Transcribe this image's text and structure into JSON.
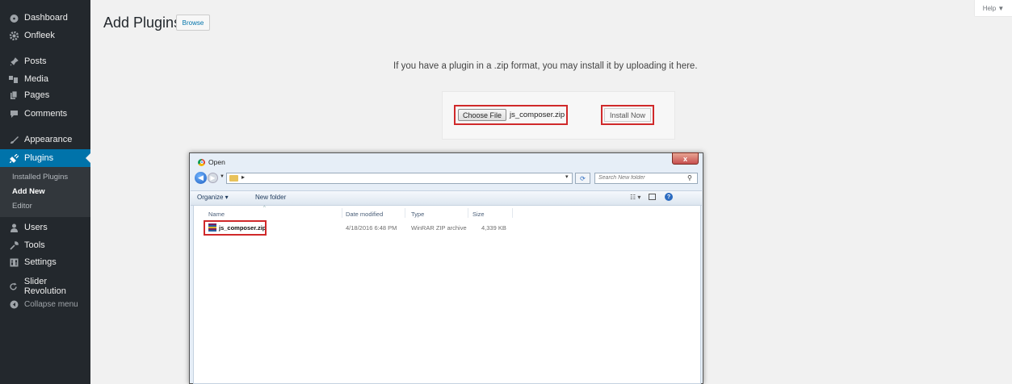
{
  "sidebar": {
    "items": [
      {
        "label": "Dashboard",
        "icon": "dashboard-icon"
      },
      {
        "label": "Onfleek",
        "icon": "gear-icon"
      },
      {
        "label": "Posts",
        "icon": "pin-icon"
      },
      {
        "label": "Media",
        "icon": "media-icon"
      },
      {
        "label": "Pages",
        "icon": "pages-icon"
      },
      {
        "label": "Comments",
        "icon": "comment-icon"
      },
      {
        "label": "Appearance",
        "icon": "brush-icon"
      },
      {
        "label": "Plugins",
        "icon": "plug-icon"
      },
      {
        "label": "Users",
        "icon": "user-icon"
      },
      {
        "label": "Tools",
        "icon": "wrench-icon"
      },
      {
        "label": "Settings",
        "icon": "settings-icon"
      },
      {
        "label": "Slider Revolution",
        "icon": "refresh-icon"
      },
      {
        "label": "Collapse menu",
        "icon": "collapse-icon"
      }
    ],
    "submenu": [
      "Installed Plugins",
      "Add New",
      "Editor"
    ]
  },
  "header": {
    "title": "Add Plugins",
    "browse_label": "Browse",
    "help_label": "Help ▼"
  },
  "upload": {
    "instruction": "If you have a plugin in a .zip format, you may install it by uploading it here.",
    "choose_label": "Choose File",
    "file_name": "js_composer.zip",
    "install_label": "Install Now"
  },
  "dialog": {
    "title": "Open",
    "close_label": "x",
    "search_placeholder": "Search New folder",
    "organize_label": "Organize ▾",
    "new_folder_label": "New folder",
    "columns": [
      "Name",
      "Date modified",
      "Type",
      "Size"
    ],
    "files": [
      {
        "name": "js_composer.zip",
        "date": "4/18/2016 6:48 PM",
        "type": "WinRAR ZIP archive",
        "size": "4,339 KB"
      }
    ]
  },
  "colors": {
    "sidebar_bg": "#23282d",
    "active": "#0073aa",
    "highlight": "#d0292a"
  }
}
